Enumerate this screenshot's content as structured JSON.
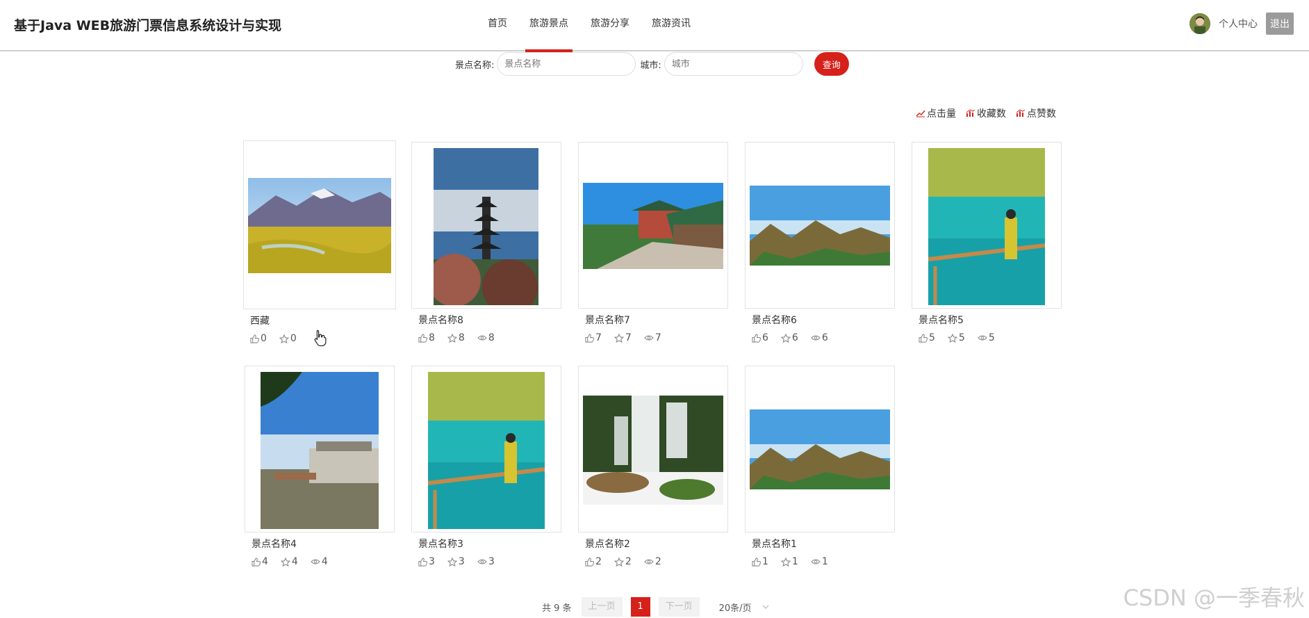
{
  "header": {
    "site_title": "基于Java WEB旅游门票信息系统设计与实现",
    "nav": [
      "首页",
      "旅游景点",
      "旅游分享",
      "旅游资讯"
    ],
    "active_nav": "旅游景点",
    "user_center": "个人中心",
    "logout": "退出"
  },
  "search": {
    "name_label": "景点名称:",
    "name_placeholder": "景点名称",
    "city_label": "城市:",
    "city_placeholder": "城市",
    "button": "查询"
  },
  "sort": [
    "点击量",
    "收藏数",
    "点赞数"
  ],
  "cards": [
    {
      "name": "西藏",
      "likes": "0",
      "favorites": "0",
      "views": ""
    },
    {
      "name": "景点名称8",
      "likes": "8",
      "favorites": "8",
      "views": "8"
    },
    {
      "name": "景点名称7",
      "likes": "7",
      "favorites": "7",
      "views": "7"
    },
    {
      "name": "景点名称6",
      "likes": "6",
      "favorites": "6",
      "views": "6"
    },
    {
      "name": "景点名称5",
      "likes": "5",
      "favorites": "5",
      "views": "5"
    },
    {
      "name": "景点名称4",
      "likes": "4",
      "favorites": "4",
      "views": "4"
    },
    {
      "name": "景点名称3",
      "likes": "3",
      "favorites": "3",
      "views": "3"
    },
    {
      "name": "景点名称2",
      "likes": "2",
      "favorites": "2",
      "views": "2"
    },
    {
      "name": "景点名称1",
      "likes": "1",
      "favorites": "1",
      "views": "1"
    }
  ],
  "pagination": {
    "total": "共 9 条",
    "prev": "上一页",
    "current": "1",
    "next": "下一页",
    "page_size": "20条/页"
  },
  "watermark": "CSDN @一季春秋",
  "colors": {
    "accent": "#d6201a"
  }
}
